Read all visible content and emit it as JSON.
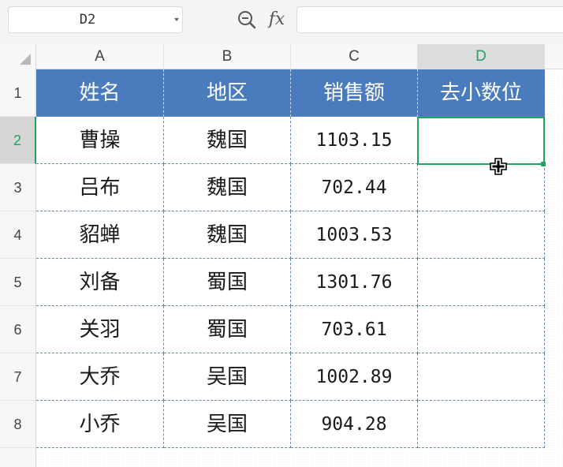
{
  "formula_bar": {
    "name_box": "D2",
    "fx_label": "fx",
    "formula_value": "",
    "zoom_icon": "zoom-out-icon"
  },
  "columns": [
    "A",
    "B",
    "C",
    "D"
  ],
  "active_column": "D",
  "rows": [
    "1",
    "2",
    "3",
    "4",
    "5",
    "6",
    "7",
    "8"
  ],
  "active_row": "2",
  "table": {
    "headers": [
      "姓名",
      "地区",
      "销售额",
      "去小数位"
    ],
    "rows": [
      [
        "曹操",
        "魏国",
        "1103.15",
        ""
      ],
      [
        "吕布",
        "魏国",
        "702.44",
        ""
      ],
      [
        "貂蝉",
        "魏国",
        "1003.53",
        ""
      ],
      [
        "刘备",
        "蜀国",
        "1301.76",
        ""
      ],
      [
        "关羽",
        "蜀国",
        "703.61",
        ""
      ],
      [
        "大乔",
        "吴国",
        "1002.89",
        ""
      ],
      [
        "小乔",
        "吴国",
        "904.28",
        ""
      ]
    ]
  },
  "selected_cell": "D2",
  "colors": {
    "header_fill": "#4a7bbd",
    "selection": "#1fa463",
    "active_header_text": "#1fa463"
  }
}
